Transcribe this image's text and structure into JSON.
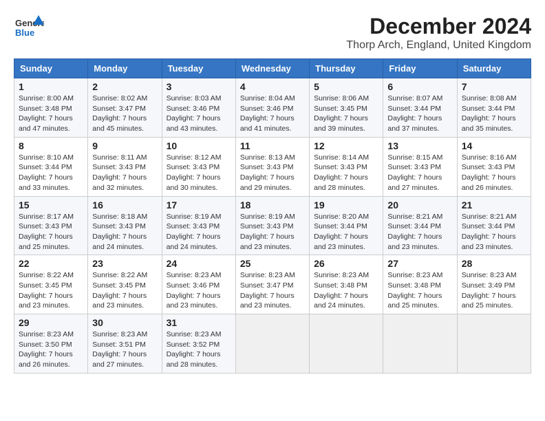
{
  "header": {
    "logo_line1": "General",
    "logo_line2": "Blue",
    "title": "December 2024",
    "subtitle": "Thorp Arch, England, United Kingdom"
  },
  "days_of_week": [
    "Sunday",
    "Monday",
    "Tuesday",
    "Wednesday",
    "Thursday",
    "Friday",
    "Saturday"
  ],
  "weeks": [
    [
      {
        "day": "1",
        "sunrise": "8:00 AM",
        "sunset": "3:48 PM",
        "daylight": "7 hours and 47 minutes."
      },
      {
        "day": "2",
        "sunrise": "8:02 AM",
        "sunset": "3:47 PM",
        "daylight": "7 hours and 45 minutes."
      },
      {
        "day": "3",
        "sunrise": "8:03 AM",
        "sunset": "3:46 PM",
        "daylight": "7 hours and 43 minutes."
      },
      {
        "day": "4",
        "sunrise": "8:04 AM",
        "sunset": "3:46 PM",
        "daylight": "7 hours and 41 minutes."
      },
      {
        "day": "5",
        "sunrise": "8:06 AM",
        "sunset": "3:45 PM",
        "daylight": "7 hours and 39 minutes."
      },
      {
        "day": "6",
        "sunrise": "8:07 AM",
        "sunset": "3:44 PM",
        "daylight": "7 hours and 37 minutes."
      },
      {
        "day": "7",
        "sunrise": "8:08 AM",
        "sunset": "3:44 PM",
        "daylight": "7 hours and 35 minutes."
      }
    ],
    [
      {
        "day": "8",
        "sunrise": "8:10 AM",
        "sunset": "3:44 PM",
        "daylight": "7 hours and 33 minutes."
      },
      {
        "day": "9",
        "sunrise": "8:11 AM",
        "sunset": "3:43 PM",
        "daylight": "7 hours and 32 minutes."
      },
      {
        "day": "10",
        "sunrise": "8:12 AM",
        "sunset": "3:43 PM",
        "daylight": "7 hours and 30 minutes."
      },
      {
        "day": "11",
        "sunrise": "8:13 AM",
        "sunset": "3:43 PM",
        "daylight": "7 hours and 29 minutes."
      },
      {
        "day": "12",
        "sunrise": "8:14 AM",
        "sunset": "3:43 PM",
        "daylight": "7 hours and 28 minutes."
      },
      {
        "day": "13",
        "sunrise": "8:15 AM",
        "sunset": "3:43 PM",
        "daylight": "7 hours and 27 minutes."
      },
      {
        "day": "14",
        "sunrise": "8:16 AM",
        "sunset": "3:43 PM",
        "daylight": "7 hours and 26 minutes."
      }
    ],
    [
      {
        "day": "15",
        "sunrise": "8:17 AM",
        "sunset": "3:43 PM",
        "daylight": "7 hours and 25 minutes."
      },
      {
        "day": "16",
        "sunrise": "8:18 AM",
        "sunset": "3:43 PM",
        "daylight": "7 hours and 24 minutes."
      },
      {
        "day": "17",
        "sunrise": "8:19 AM",
        "sunset": "3:43 PM",
        "daylight": "7 hours and 24 minutes."
      },
      {
        "day": "18",
        "sunrise": "8:19 AM",
        "sunset": "3:43 PM",
        "daylight": "7 hours and 23 minutes."
      },
      {
        "day": "19",
        "sunrise": "8:20 AM",
        "sunset": "3:44 PM",
        "daylight": "7 hours and 23 minutes."
      },
      {
        "day": "20",
        "sunrise": "8:21 AM",
        "sunset": "3:44 PM",
        "daylight": "7 hours and 23 minutes."
      },
      {
        "day": "21",
        "sunrise": "8:21 AM",
        "sunset": "3:44 PM",
        "daylight": "7 hours and 23 minutes."
      }
    ],
    [
      {
        "day": "22",
        "sunrise": "8:22 AM",
        "sunset": "3:45 PM",
        "daylight": "7 hours and 23 minutes."
      },
      {
        "day": "23",
        "sunrise": "8:22 AM",
        "sunset": "3:45 PM",
        "daylight": "7 hours and 23 minutes."
      },
      {
        "day": "24",
        "sunrise": "8:23 AM",
        "sunset": "3:46 PM",
        "daylight": "7 hours and 23 minutes."
      },
      {
        "day": "25",
        "sunrise": "8:23 AM",
        "sunset": "3:47 PM",
        "daylight": "7 hours and 23 minutes."
      },
      {
        "day": "26",
        "sunrise": "8:23 AM",
        "sunset": "3:48 PM",
        "daylight": "7 hours and 24 minutes."
      },
      {
        "day": "27",
        "sunrise": "8:23 AM",
        "sunset": "3:48 PM",
        "daylight": "7 hours and 25 minutes."
      },
      {
        "day": "28",
        "sunrise": "8:23 AM",
        "sunset": "3:49 PM",
        "daylight": "7 hours and 25 minutes."
      }
    ],
    [
      {
        "day": "29",
        "sunrise": "8:23 AM",
        "sunset": "3:50 PM",
        "daylight": "7 hours and 26 minutes."
      },
      {
        "day": "30",
        "sunrise": "8:23 AM",
        "sunset": "3:51 PM",
        "daylight": "7 hours and 27 minutes."
      },
      {
        "day": "31",
        "sunrise": "8:23 AM",
        "sunset": "3:52 PM",
        "daylight": "7 hours and 28 minutes."
      },
      null,
      null,
      null,
      null
    ]
  ],
  "labels": {
    "sunrise": "Sunrise:",
    "sunset": "Sunset:",
    "daylight": "Daylight:"
  }
}
